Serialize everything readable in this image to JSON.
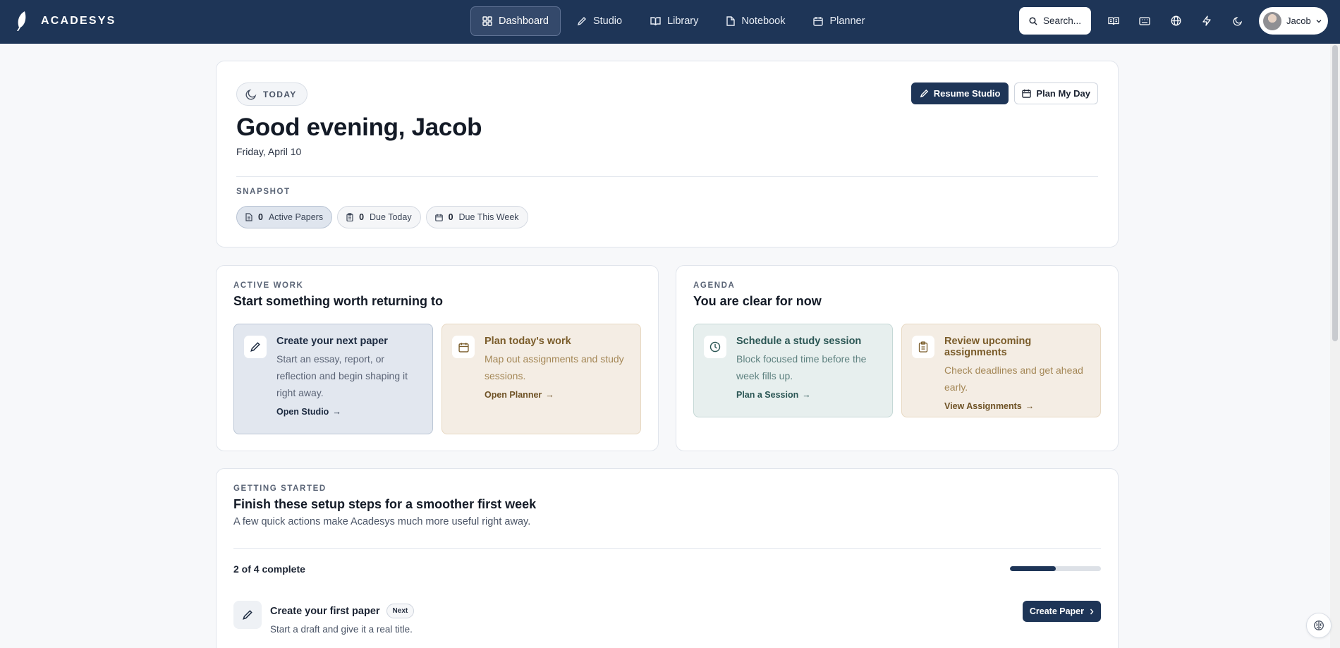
{
  "brand": {
    "name": "ACADESYS"
  },
  "nav": {
    "tabs": [
      {
        "label": "Dashboard",
        "icon": "grid-icon",
        "active": true
      },
      {
        "label": "Studio",
        "icon": "pen-icon"
      },
      {
        "label": "Library",
        "icon": "book-icon"
      },
      {
        "label": "Notebook",
        "icon": "file-icon"
      },
      {
        "label": "Planner",
        "icon": "calendar-icon"
      }
    ],
    "search_label": "Search...",
    "user_name": "Jacob"
  },
  "hero": {
    "pill": "TODAY",
    "greeting": "Good evening, Jacob",
    "date": "Friday, April 10",
    "resume_label": "Resume Studio",
    "plan_label": "Plan My Day",
    "snapshot_label": "SNAPSHOT",
    "chips": [
      {
        "count": "0",
        "label": "Active Papers"
      },
      {
        "count": "0",
        "label": "Due Today"
      },
      {
        "count": "0",
        "label": "Due This Week"
      }
    ]
  },
  "active_work": {
    "eyebrow": "ACTIVE WORK",
    "title": "Start something worth returning to",
    "tiles": [
      {
        "title": "Create your next paper",
        "desc": "Start an essay, report, or reflection and begin shaping it right away.",
        "link": "Open Studio"
      },
      {
        "title": "Plan today's work",
        "desc": "Map out assignments and study sessions.",
        "link": "Open Planner"
      }
    ]
  },
  "agenda": {
    "eyebrow": "AGENDA",
    "title": "You are clear for now",
    "tiles": [
      {
        "title": "Schedule a study session",
        "desc": "Block focused time before the week fills up.",
        "link": "Plan a Session"
      },
      {
        "title": "Review upcoming assignments",
        "desc": "Check deadlines and get ahead early.",
        "link": "View Assignments"
      }
    ]
  },
  "getting_started": {
    "eyebrow": "GETTING STARTED",
    "title": "Finish these setup steps for a smoother first week",
    "subtitle": "A few quick actions make Acadesys much more useful right away.",
    "progress_text": "2 of 4 complete",
    "progress_fraction": 0.5,
    "step": {
      "title": "Create your first paper",
      "badge": "Next",
      "desc": "Start a draft and give it a real title.",
      "button": "Create Paper"
    }
  },
  "colors": {
    "nav_bg": "#1e3557",
    "accent": "#1e3557"
  }
}
